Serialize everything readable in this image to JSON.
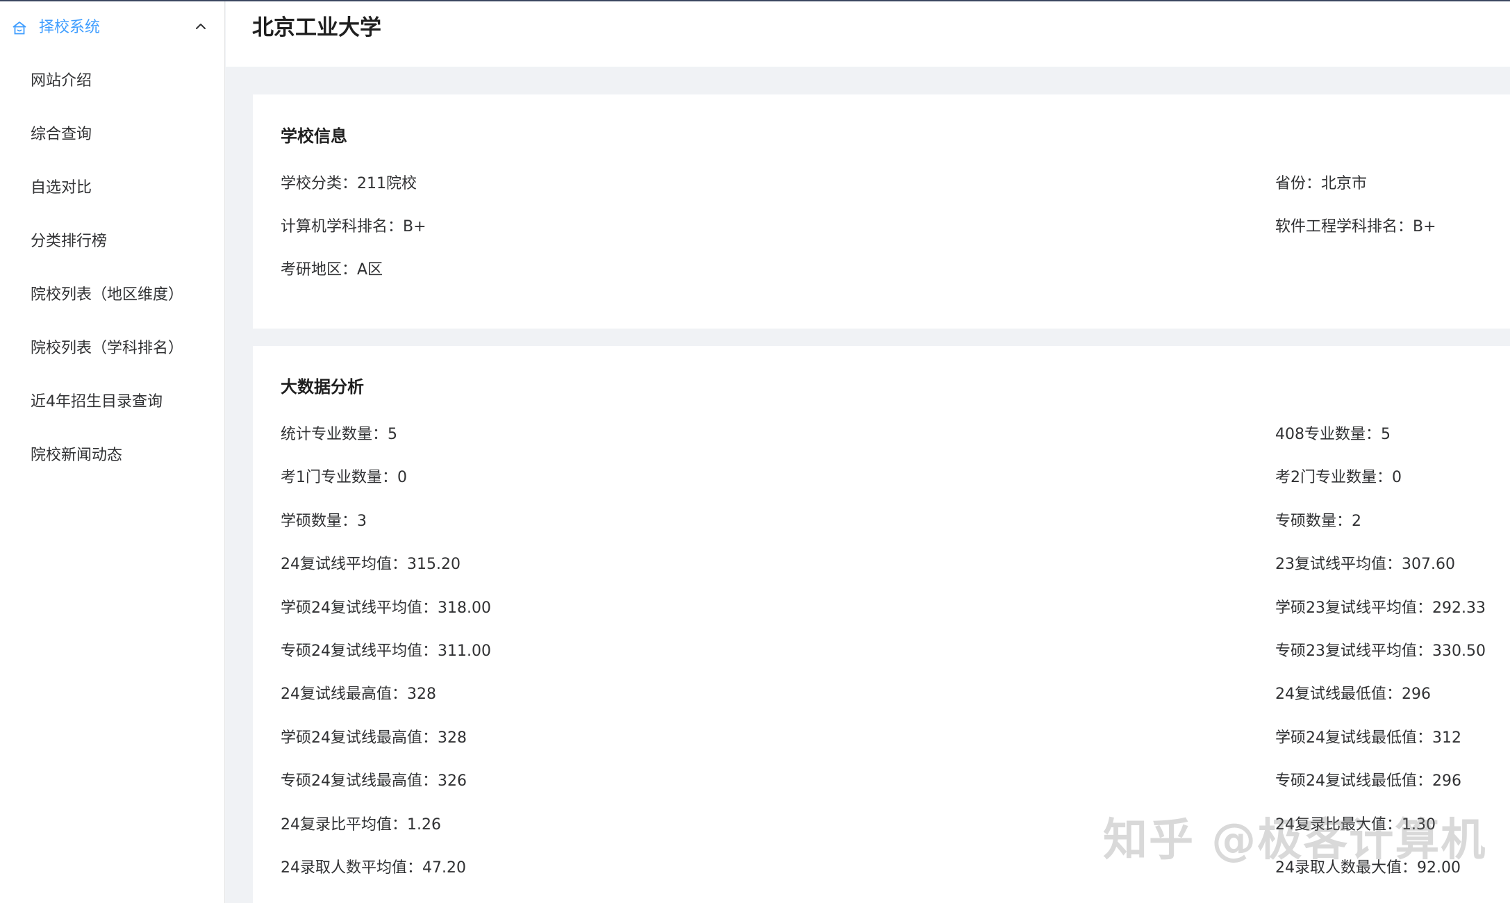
{
  "sidebar": {
    "menu_title": "择校系统",
    "items": [
      {
        "label": "网站介绍"
      },
      {
        "label": "综合查询"
      },
      {
        "label": "自选对比"
      },
      {
        "label": "分类排行榜"
      },
      {
        "label": "院校列表（地区维度）"
      },
      {
        "label": "院校列表（学科排名）"
      },
      {
        "label": "近4年招生目录查询"
      },
      {
        "label": "院校新闻动态"
      }
    ]
  },
  "header": {
    "title": "北京工业大学"
  },
  "school_info": {
    "title": "学校信息",
    "rows": [
      {
        "left": "学校分类：211院校",
        "right": "省份：北京市"
      },
      {
        "left": "计算机学科排名：B+",
        "right": "软件工程学科排名：B+"
      },
      {
        "left": "考研地区：A区",
        "right": ""
      }
    ]
  },
  "big_data": {
    "title": "大数据分析",
    "rows": [
      {
        "left": "统计专业数量：5",
        "right": "408专业数量：5"
      },
      {
        "left": "考1门专业数量：0",
        "right": "考2门专业数量：0"
      },
      {
        "left": "学硕数量：3",
        "right": "专硕数量：2"
      },
      {
        "left": "24复试线平均值：315.20",
        "right": "23复试线平均值：307.60"
      },
      {
        "left": "学硕24复试线平均值：318.00",
        "right": "学硕23复试线平均值：292.33"
      },
      {
        "left": "专硕24复试线平均值：311.00",
        "right": "专硕23复试线平均值：330.50"
      },
      {
        "left": "24复试线最高值：328",
        "right": "24复试线最低值：296"
      },
      {
        "left": "学硕24复试线最高值：328",
        "right": "学硕24复试线最低值：312"
      },
      {
        "left": "专硕24复试线最高值：326",
        "right": "专硕24复试线最低值：296"
      },
      {
        "left": "24复录比平均值：1.26",
        "right": "24复录比最大值：1.30"
      },
      {
        "left": "24录取人数平均值：47.20",
        "right": "24录取人数最大值：92.00"
      }
    ]
  },
  "watermark": "知乎 @极客计算机",
  "colors": {
    "accent": "#409eff",
    "background": "#f0f2f5",
    "card": "#ffffff",
    "text": "#303133"
  }
}
